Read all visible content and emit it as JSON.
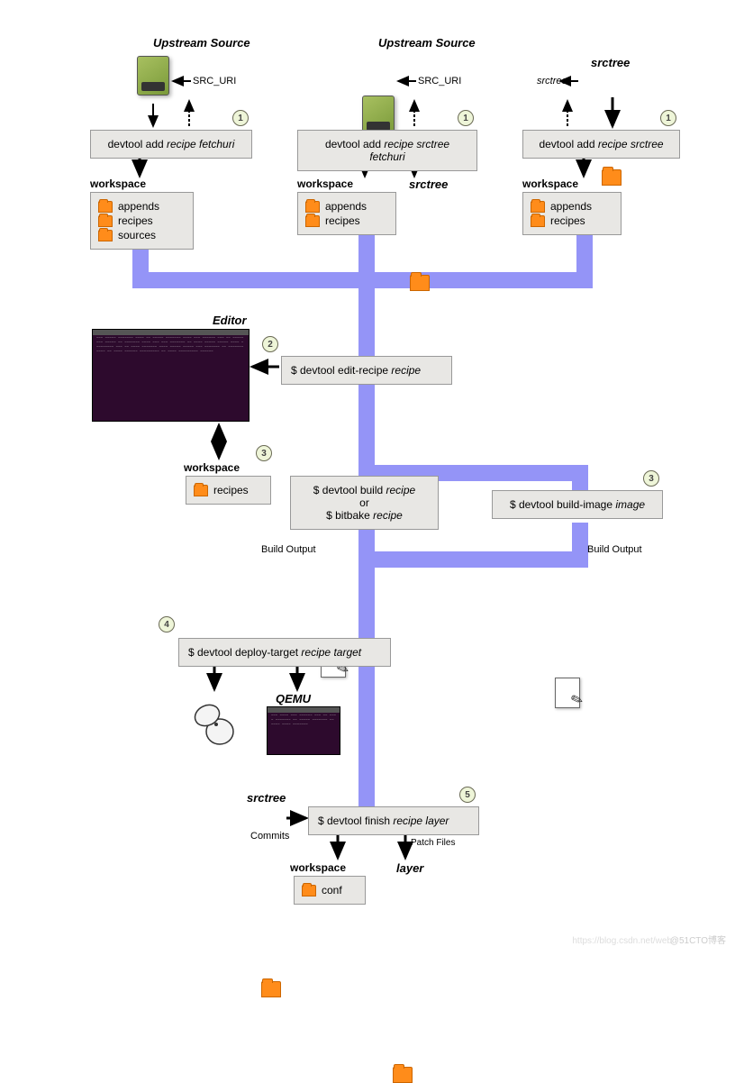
{
  "titles": {
    "upstream1": "Upstream Source",
    "upstream2": "Upstream Source",
    "srctree": "srctree",
    "editor": "Editor",
    "qemu": "QEMU",
    "workspace": "workspace",
    "layer": "layer",
    "srctree_commits": "srctree"
  },
  "labels": {
    "src_uri": "SRC_URI",
    "srctree_small": "srctree",
    "commits": "Commits",
    "patch_files": "Patch Files",
    "build_output1": "Build Output",
    "build_output2": "Build Output"
  },
  "commands": {
    "add1_pre": "devtool add ",
    "add1_arg": "recipe fetchuri",
    "add2_pre": "devtool add ",
    "add2_arg": "recipe srctree fetchuri",
    "add3_pre": "devtool add ",
    "add3_arg": "recipe srctree",
    "edit_pre": "$ devtool edit-recipe ",
    "edit_arg": "recipe",
    "build_pre": "$ devtool build ",
    "build_arg": "recipe",
    "build_or": "or",
    "bitbake_pre": "$ bitbake ",
    "bitbake_arg": "recipe",
    "build_image_pre": "$ devtool build-image ",
    "build_image_arg": "image",
    "deploy_pre": "$ devtool deploy-target ",
    "deploy_arg": "recipe target",
    "finish_pre": "$ devtool finish ",
    "finish_arg": "recipe layer"
  },
  "folders": {
    "appends": "appends",
    "recipes": "recipes",
    "sources": "sources",
    "conf": "conf"
  },
  "steps": {
    "s1": "1",
    "s2": "2",
    "s3": "3",
    "s4": "4",
    "s5": "5"
  },
  "watermark": "@51CTO博客",
  "watermark2": "https://blog.csdn.net/web"
}
